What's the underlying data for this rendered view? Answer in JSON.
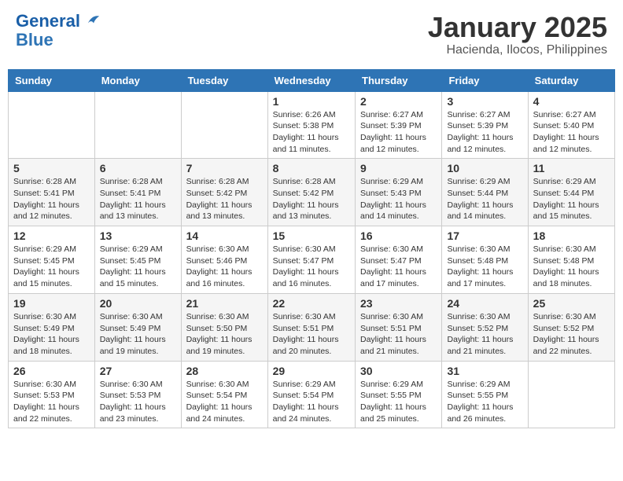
{
  "header": {
    "logo_line1": "General",
    "logo_line2": "Blue",
    "month_title": "January 2025",
    "location": "Hacienda, Ilocos, Philippines"
  },
  "calendar": {
    "days_of_week": [
      "Sunday",
      "Monday",
      "Tuesday",
      "Wednesday",
      "Thursday",
      "Friday",
      "Saturday"
    ],
    "weeks": [
      [
        {
          "day": "",
          "sunrise": "",
          "sunset": "",
          "daylight": ""
        },
        {
          "day": "",
          "sunrise": "",
          "sunset": "",
          "daylight": ""
        },
        {
          "day": "",
          "sunrise": "",
          "sunset": "",
          "daylight": ""
        },
        {
          "day": "1",
          "sunrise": "Sunrise: 6:26 AM",
          "sunset": "Sunset: 5:38 PM",
          "daylight": "Daylight: 11 hours and 11 minutes."
        },
        {
          "day": "2",
          "sunrise": "Sunrise: 6:27 AM",
          "sunset": "Sunset: 5:39 PM",
          "daylight": "Daylight: 11 hours and 12 minutes."
        },
        {
          "day": "3",
          "sunrise": "Sunrise: 6:27 AM",
          "sunset": "Sunset: 5:39 PM",
          "daylight": "Daylight: 11 hours and 12 minutes."
        },
        {
          "day": "4",
          "sunrise": "Sunrise: 6:27 AM",
          "sunset": "Sunset: 5:40 PM",
          "daylight": "Daylight: 11 hours and 12 minutes."
        }
      ],
      [
        {
          "day": "5",
          "sunrise": "Sunrise: 6:28 AM",
          "sunset": "Sunset: 5:41 PM",
          "daylight": "Daylight: 11 hours and 12 minutes."
        },
        {
          "day": "6",
          "sunrise": "Sunrise: 6:28 AM",
          "sunset": "Sunset: 5:41 PM",
          "daylight": "Daylight: 11 hours and 13 minutes."
        },
        {
          "day": "7",
          "sunrise": "Sunrise: 6:28 AM",
          "sunset": "Sunset: 5:42 PM",
          "daylight": "Daylight: 11 hours and 13 minutes."
        },
        {
          "day": "8",
          "sunrise": "Sunrise: 6:28 AM",
          "sunset": "Sunset: 5:42 PM",
          "daylight": "Daylight: 11 hours and 13 minutes."
        },
        {
          "day": "9",
          "sunrise": "Sunrise: 6:29 AM",
          "sunset": "Sunset: 5:43 PM",
          "daylight": "Daylight: 11 hours and 14 minutes."
        },
        {
          "day": "10",
          "sunrise": "Sunrise: 6:29 AM",
          "sunset": "Sunset: 5:44 PM",
          "daylight": "Daylight: 11 hours and 14 minutes."
        },
        {
          "day": "11",
          "sunrise": "Sunrise: 6:29 AM",
          "sunset": "Sunset: 5:44 PM",
          "daylight": "Daylight: 11 hours and 15 minutes."
        }
      ],
      [
        {
          "day": "12",
          "sunrise": "Sunrise: 6:29 AM",
          "sunset": "Sunset: 5:45 PM",
          "daylight": "Daylight: 11 hours and 15 minutes."
        },
        {
          "day": "13",
          "sunrise": "Sunrise: 6:29 AM",
          "sunset": "Sunset: 5:45 PM",
          "daylight": "Daylight: 11 hours and 15 minutes."
        },
        {
          "day": "14",
          "sunrise": "Sunrise: 6:30 AM",
          "sunset": "Sunset: 5:46 PM",
          "daylight": "Daylight: 11 hours and 16 minutes."
        },
        {
          "day": "15",
          "sunrise": "Sunrise: 6:30 AM",
          "sunset": "Sunset: 5:47 PM",
          "daylight": "Daylight: 11 hours and 16 minutes."
        },
        {
          "day": "16",
          "sunrise": "Sunrise: 6:30 AM",
          "sunset": "Sunset: 5:47 PM",
          "daylight": "Daylight: 11 hours and 17 minutes."
        },
        {
          "day": "17",
          "sunrise": "Sunrise: 6:30 AM",
          "sunset": "Sunset: 5:48 PM",
          "daylight": "Daylight: 11 hours and 17 minutes."
        },
        {
          "day": "18",
          "sunrise": "Sunrise: 6:30 AM",
          "sunset": "Sunset: 5:48 PM",
          "daylight": "Daylight: 11 hours and 18 minutes."
        }
      ],
      [
        {
          "day": "19",
          "sunrise": "Sunrise: 6:30 AM",
          "sunset": "Sunset: 5:49 PM",
          "daylight": "Daylight: 11 hours and 18 minutes."
        },
        {
          "day": "20",
          "sunrise": "Sunrise: 6:30 AM",
          "sunset": "Sunset: 5:49 PM",
          "daylight": "Daylight: 11 hours and 19 minutes."
        },
        {
          "day": "21",
          "sunrise": "Sunrise: 6:30 AM",
          "sunset": "Sunset: 5:50 PM",
          "daylight": "Daylight: 11 hours and 19 minutes."
        },
        {
          "day": "22",
          "sunrise": "Sunrise: 6:30 AM",
          "sunset": "Sunset: 5:51 PM",
          "daylight": "Daylight: 11 hours and 20 minutes."
        },
        {
          "day": "23",
          "sunrise": "Sunrise: 6:30 AM",
          "sunset": "Sunset: 5:51 PM",
          "daylight": "Daylight: 11 hours and 21 minutes."
        },
        {
          "day": "24",
          "sunrise": "Sunrise: 6:30 AM",
          "sunset": "Sunset: 5:52 PM",
          "daylight": "Daylight: 11 hours and 21 minutes."
        },
        {
          "day": "25",
          "sunrise": "Sunrise: 6:30 AM",
          "sunset": "Sunset: 5:52 PM",
          "daylight": "Daylight: 11 hours and 22 minutes."
        }
      ],
      [
        {
          "day": "26",
          "sunrise": "Sunrise: 6:30 AM",
          "sunset": "Sunset: 5:53 PM",
          "daylight": "Daylight: 11 hours and 22 minutes."
        },
        {
          "day": "27",
          "sunrise": "Sunrise: 6:30 AM",
          "sunset": "Sunset: 5:53 PM",
          "daylight": "Daylight: 11 hours and 23 minutes."
        },
        {
          "day": "28",
          "sunrise": "Sunrise: 6:30 AM",
          "sunset": "Sunset: 5:54 PM",
          "daylight": "Daylight: 11 hours and 24 minutes."
        },
        {
          "day": "29",
          "sunrise": "Sunrise: 6:29 AM",
          "sunset": "Sunset: 5:54 PM",
          "daylight": "Daylight: 11 hours and 24 minutes."
        },
        {
          "day": "30",
          "sunrise": "Sunrise: 6:29 AM",
          "sunset": "Sunset: 5:55 PM",
          "daylight": "Daylight: 11 hours and 25 minutes."
        },
        {
          "day": "31",
          "sunrise": "Sunrise: 6:29 AM",
          "sunset": "Sunset: 5:55 PM",
          "daylight": "Daylight: 11 hours and 26 minutes."
        },
        {
          "day": "",
          "sunrise": "",
          "sunset": "",
          "daylight": ""
        }
      ]
    ]
  }
}
